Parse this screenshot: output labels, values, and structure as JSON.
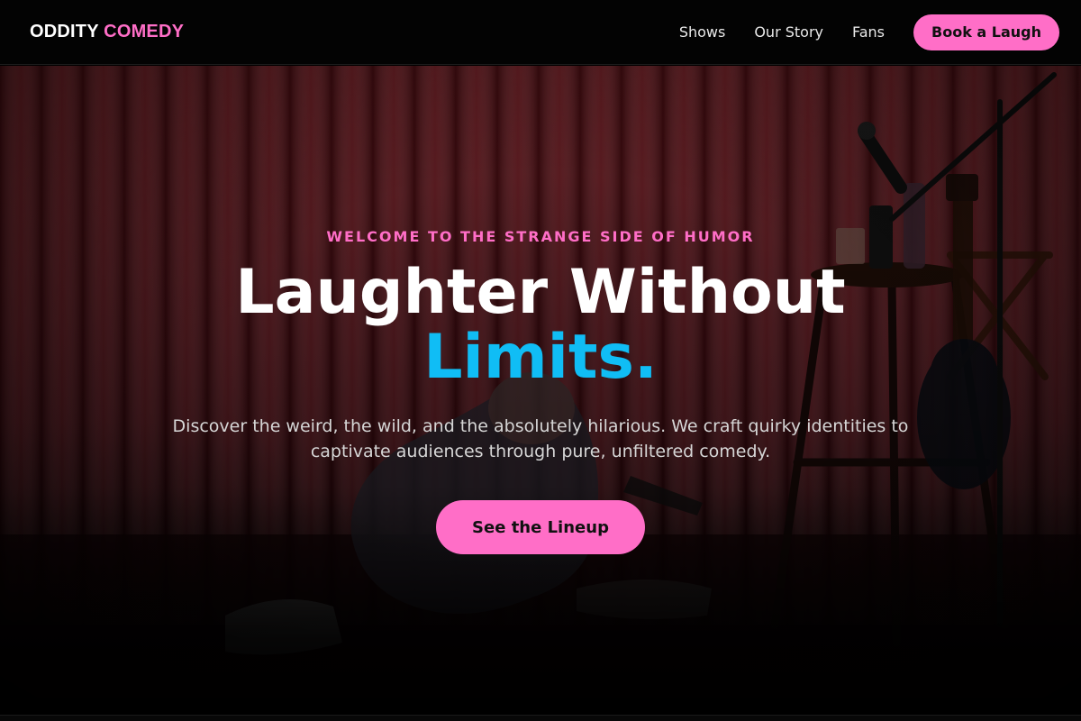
{
  "brand": {
    "name_part1": "ODDITY",
    "name_part2": "COMEDY"
  },
  "nav": {
    "links": [
      "Shows",
      "Our Story",
      "Fans"
    ],
    "cta_label": "Book a Laugh"
  },
  "hero": {
    "eyebrow": "WELCOME TO THE STRANGE SIDE OF HUMOR",
    "headline_line1": "Laughter Without",
    "headline_accent": "Limits.",
    "subtitle": "Discover the weird, the wild, and the absolutely hilarious. We craft quirky identities to captivate audiences through pure, unfiltered comedy.",
    "cta_label": "See the Lineup",
    "background_description_icon": "stage-photo-comedian-on-floor"
  },
  "colors": {
    "accent_pink": "#ff6ec7",
    "accent_blue": "#10bdf5",
    "navbar_bg": "#030303",
    "curtain_red": "#8a1a22"
  }
}
